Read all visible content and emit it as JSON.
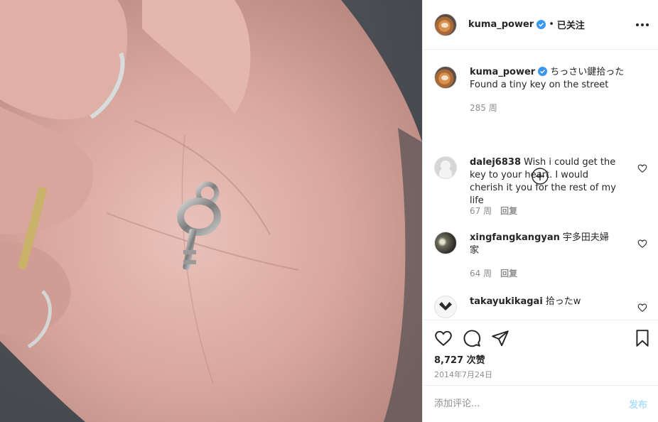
{
  "post": {
    "image_description_icon": "photo-hand-key",
    "author": "kuma_power",
    "follow_status": "已关注",
    "dot": "•",
    "caption_line1": "ちっさい鍵拾った",
    "caption_line2": "Found a tiny key on the street",
    "caption_age": "285 周",
    "likes": "8,727 次赞",
    "date": "2014年7月24日"
  },
  "comments": [
    {
      "user": "dalej6838",
      "text": "Wish i could get the key to your heart. I would cherish it you for the rest of my life",
      "age": "67 周",
      "reply": "回复"
    },
    {
      "user": "xingfangkangyan",
      "text": "宇多田夫婦家",
      "age": "64 周",
      "reply": "回复"
    },
    {
      "user": "takayukikagai",
      "text": "拾ったw"
    }
  ],
  "composer": {
    "placeholder": "添加评论...",
    "post_label": "发布"
  },
  "colors": {
    "verified_blue": "#3897f0",
    "post_button_disabled": "#b2dffc",
    "secondary_text": "#8e8e8e"
  },
  "icons": {
    "like": "heart-icon",
    "comment": "comment-icon",
    "share": "paper-plane-icon",
    "save": "bookmark-icon",
    "more": "more-options-icon",
    "load_more": "plus-circle-icon"
  }
}
